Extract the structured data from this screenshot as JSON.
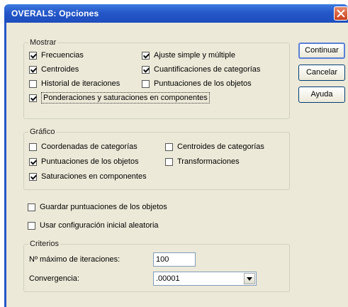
{
  "dialog": {
    "title": "OVERALS: Opciones"
  },
  "buttons": {
    "continue": "Continuar",
    "cancel": "Cancelar",
    "help": "Ayuda"
  },
  "mostrar": {
    "label": "Mostrar",
    "options": [
      {
        "label": "Frecuencias",
        "checked": true
      },
      {
        "label": "Ajuste simple y múltiple",
        "checked": true
      },
      {
        "label": "Centroides",
        "checked": true
      },
      {
        "label": "Cuantificaciones de categorías",
        "checked": true
      },
      {
        "label": "Historial de iteraciones",
        "checked": false
      },
      {
        "label": "Puntuaciones de los objetos",
        "checked": false
      },
      {
        "label": "Ponderaciones y saturaciones en componentes",
        "checked": true
      }
    ]
  },
  "grafico": {
    "label": "Gráfico",
    "options": [
      {
        "label": "Coordenadas de categorías",
        "checked": false
      },
      {
        "label": "Centroides de categorías",
        "checked": false
      },
      {
        "label": "Puntuaciones de los objetos",
        "checked": true
      },
      {
        "label": "Transformaciones",
        "checked": false
      },
      {
        "label": "Saturaciones en componentes",
        "checked": true
      }
    ]
  },
  "extra": [
    {
      "label": "Guardar puntuaciones de los objetos",
      "checked": false
    },
    {
      "label": "Usar configuración inicial aleatoria",
      "checked": false
    }
  ],
  "criterios": {
    "label": "Criterios",
    "max_iter_label": "Nº máximo de iteraciones:",
    "max_iter_value": "100",
    "convergence_label": "Convergencia:",
    "convergence_value": ".00001"
  }
}
